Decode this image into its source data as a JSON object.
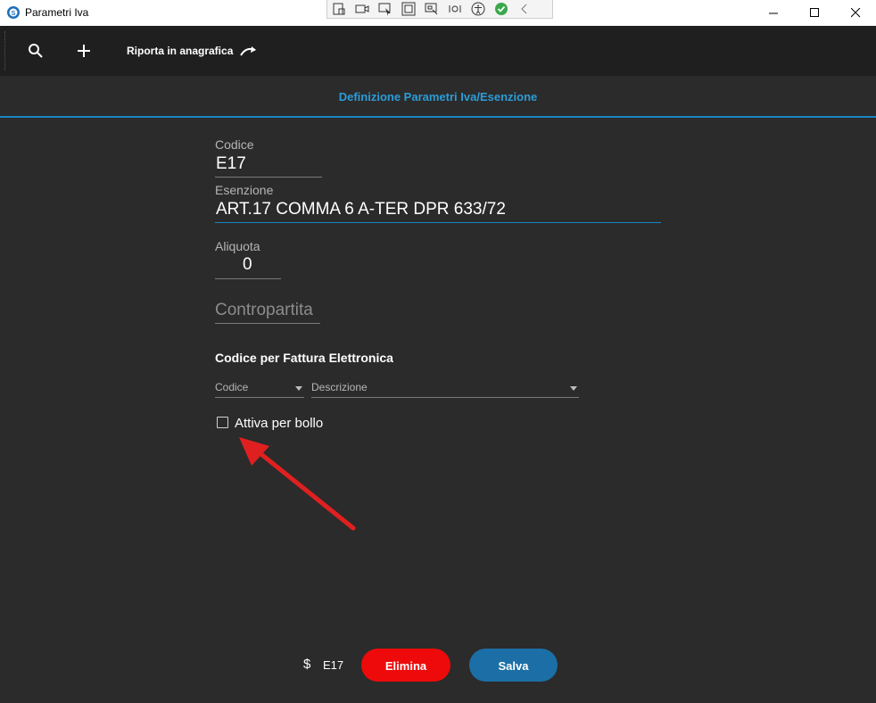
{
  "window": {
    "title": "Parametri Iva"
  },
  "toolbar": {
    "action_label": "Riporta in anagrafica"
  },
  "header": {
    "title": "Definizione Parametri Iva/Esenzione"
  },
  "form": {
    "codice_label": "Codice",
    "codice_value": "E17",
    "esenzione_label": "Esenzione",
    "esenzione_value": "ART.17 COMMA 6 A-TER  DPR 633/72",
    "aliquota_label": "Aliquota",
    "aliquota_value": "0",
    "contropartita_placeholder": "Contropartita",
    "section_title": "Codice per Fattura Elettronica",
    "fe_codice_placeholder": "Codice",
    "fe_descrizione_placeholder": "Descrizione",
    "checkbox_label": "Attiva per bollo",
    "checkbox_checked": false
  },
  "footer": {
    "code": "E17",
    "delete_label": "Elimina",
    "save_label": "Salva"
  },
  "colors": {
    "accent": "#1a86c6",
    "danger": "#ee0a0a",
    "primary": "#1c6fa6",
    "annotation": "#e02020"
  }
}
